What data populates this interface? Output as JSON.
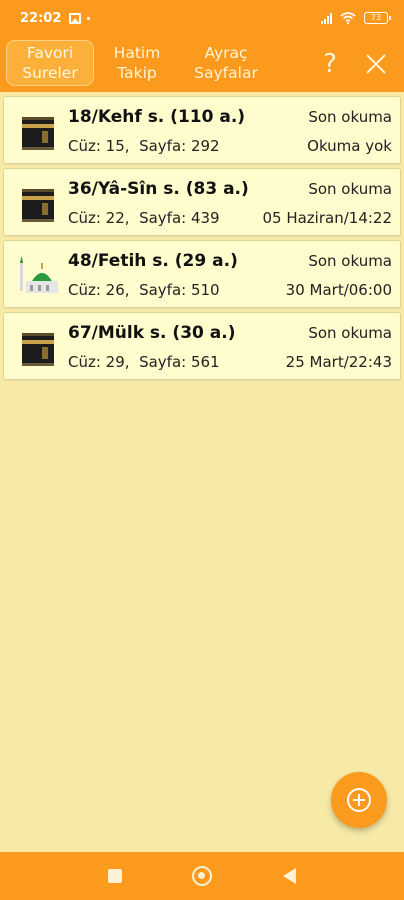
{
  "status_bar": {
    "time": "22:02",
    "battery": "73"
  },
  "toolbar": {
    "tabs": [
      {
        "line1": "Favori",
        "line2": "Sureler"
      },
      {
        "line1": "Hatim",
        "line2": "Takip"
      },
      {
        "line1": "Ayraç",
        "line2": "Sayfalar"
      }
    ],
    "help_label": "?",
    "close_icon": "close-icon"
  },
  "list": {
    "items": [
      {
        "title": "18/Kehf s. (110 a.)",
        "sub": "Cüz: 15,  Sayfa: 292",
        "status": "Son okuma",
        "date": "Okuma yok",
        "icon": "kaaba-icon"
      },
      {
        "title": "36/Yâ-Sîn s. (83 a.)",
        "sub": "Cüz: 22,  Sayfa: 439",
        "status": "Son okuma",
        "date": "05 Haziran/14:22",
        "icon": "kaaba-icon"
      },
      {
        "title": "48/Fetih s. (29 a.)",
        "sub": "Cüz: 26,  Sayfa: 510",
        "status": "Son okuma",
        "date": "30 Mart/06:00",
        "icon": "mosque-icon"
      },
      {
        "title": "67/Mülk s. (30 a.)",
        "sub": "Cüz: 29,  Sayfa: 561",
        "status": "Son okuma",
        "date": "25 Mart/22:43",
        "icon": "kaaba-icon"
      }
    ]
  },
  "fab": {
    "icon": "add-circle-icon"
  },
  "colors": {
    "accent": "#fb9a1c",
    "background": "#f7eaa7",
    "card": "#fffccd"
  }
}
